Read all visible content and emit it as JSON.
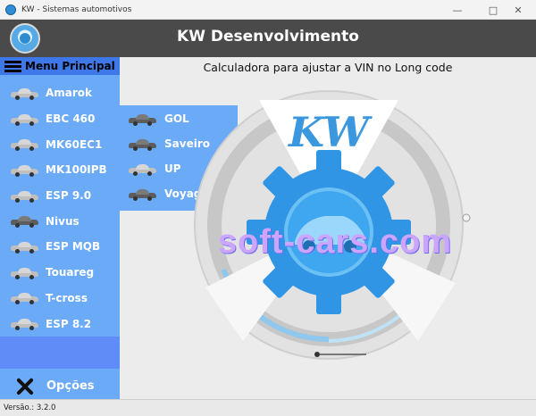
{
  "window": {
    "title": "KW - Sistemas automotivos",
    "controls": {
      "minimize": "—",
      "maximize": "□",
      "close": "✕"
    }
  },
  "header": {
    "title": "KW Desenvolvimento"
  },
  "sidebar": {
    "menu_title": "Menu Principal",
    "items": [
      {
        "label": "Amarok",
        "icon": "car-icon"
      },
      {
        "label": "EBC 460",
        "icon": "car-icon"
      },
      {
        "label": "MK60EC1",
        "icon": "car-icon"
      },
      {
        "label": "MK100IPB",
        "icon": "car-icon"
      },
      {
        "label": "ESP 9.0",
        "icon": "car-icon"
      },
      {
        "label": "Nivus",
        "icon": "car-icon"
      },
      {
        "label": "ESP MQB",
        "icon": "car-icon"
      },
      {
        "label": "Touareg",
        "icon": "car-icon"
      },
      {
        "label": "T-cross",
        "icon": "car-icon"
      },
      {
        "label": "ESP 8.2",
        "icon": "car-icon"
      }
    ],
    "options_label": "Opções"
  },
  "submenu": {
    "items": [
      {
        "label": "GOL",
        "icon": "car-icon"
      },
      {
        "label": "Saveiro",
        "icon": "car-icon"
      },
      {
        "label": "UP",
        "icon": "car-icon"
      },
      {
        "label": "Voyagem",
        "icon": "car-icon"
      }
    ]
  },
  "main": {
    "subtitle": "Calculadora para ajustar a VIN no Long code",
    "logo_text": "KW",
    "watermark": "soft-cars.com"
  },
  "status": {
    "version": "Versão.: 3.2.0"
  },
  "colors": {
    "header_bg": "#4a4a4a",
    "sidebar_bg": "#6aaaf7",
    "menu_header_bg": "#3e77e7",
    "gear_blue": "#2f95e4"
  }
}
